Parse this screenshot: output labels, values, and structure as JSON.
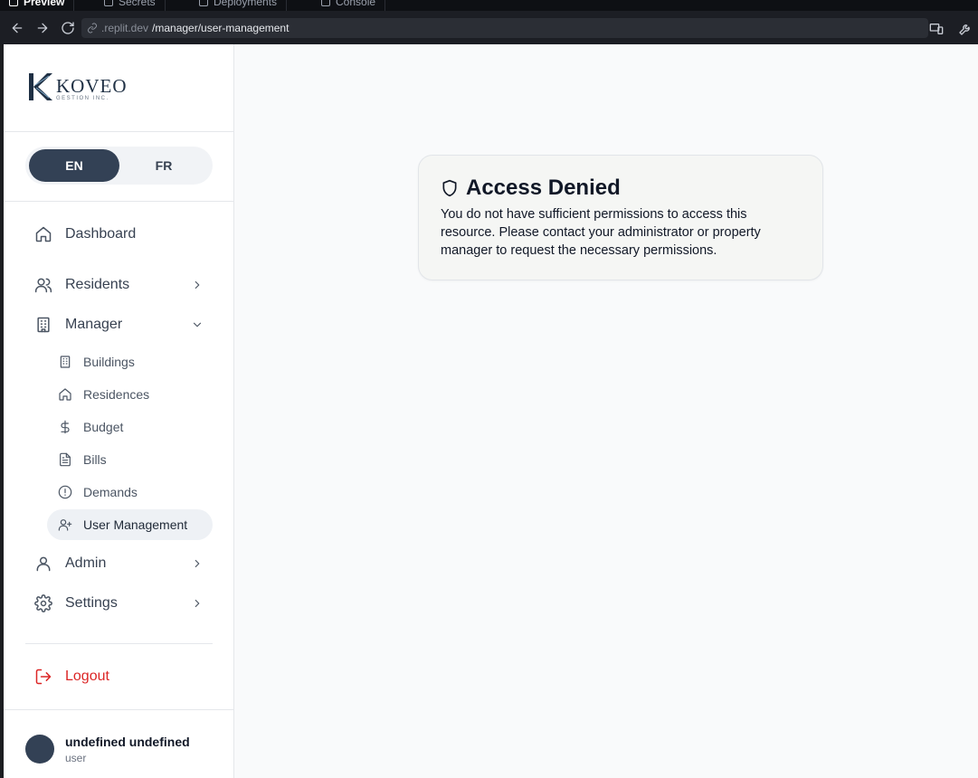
{
  "browser": {
    "tabs": [
      {
        "label": "Preview",
        "active": true
      },
      {
        "label": "Secrets",
        "active": false
      },
      {
        "label": "Deployments",
        "active": false
      },
      {
        "label": "Console",
        "active": false
      }
    ],
    "url_host": ".replit.dev",
    "url_path": "/manager/user-management"
  },
  "brand": {
    "name": "KOVEO",
    "subtitle": "GESTION INC.",
    "colors": {
      "primary": "#334155",
      "danger": "#dc2626"
    }
  },
  "lang": {
    "en": "EN",
    "fr": "FR",
    "selected": "EN"
  },
  "nav": {
    "dashboard": "Dashboard",
    "residents": "Residents",
    "manager": "Manager",
    "manager_items": {
      "buildings": "Buildings",
      "residences": "Residences",
      "budget": "Budget",
      "bills": "Bills",
      "demands": "Demands",
      "user_management": "User Management"
    },
    "admin": "Admin",
    "settings": "Settings",
    "logout": "Logout"
  },
  "user": {
    "name": "undefined undefined",
    "role": "user"
  },
  "access_denied": {
    "title": "Access Denied",
    "message": "You do not have sufficient permissions to access this resource. Please contact your administrator or property manager to request the necessary permissions."
  }
}
